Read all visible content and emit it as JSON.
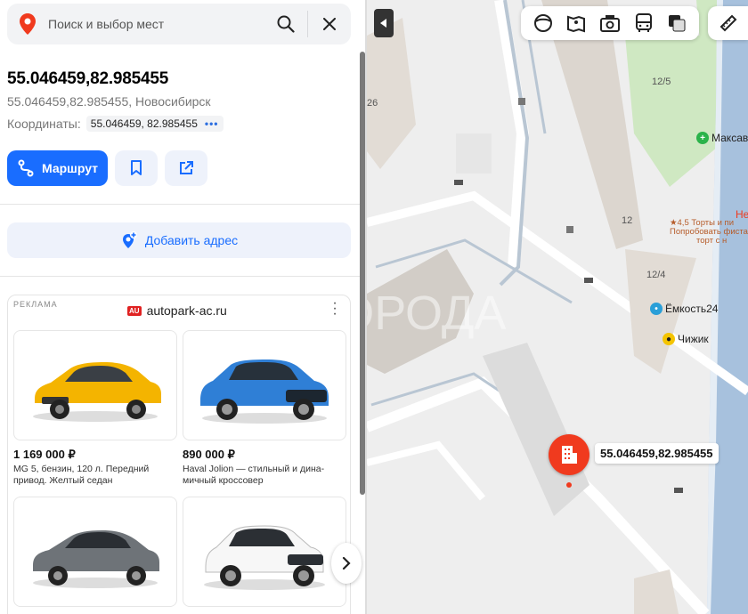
{
  "search": {
    "placeholder": "Поиск и выбор мест"
  },
  "place": {
    "title": "55.046459,82.985455",
    "subtitle": "55.046459,82.985455, Новосибирск",
    "coords_label": "Координаты:",
    "coords_value": "55.046459, 82.985455",
    "coords_more": "•••"
  },
  "actions": {
    "route_label": "Маршрут"
  },
  "add_address": {
    "label": "Добавить адрес"
  },
  "ad": {
    "label": "РЕКЛАМА",
    "brand_logo": "AU",
    "brand": "autopark-ac.ru",
    "cards": [
      {
        "price": "1 169 000 ₽",
        "desc": "MG 5, бензин, 120 л. Передний привод. Желтый седан",
        "color": "#f4b400"
      },
      {
        "price": "890 000 ₽",
        "desc": "Haval Jolion — стильный и дина-мичный кроссовер",
        "color": "#2f7fd6"
      },
      {
        "price": "",
        "desc": "",
        "color": "#6e7378"
      },
      {
        "price": "",
        "desc": "",
        "color": "#f7f7f7"
      }
    ]
  },
  "map": {
    "labels": {
      "n12_5": "12/5",
      "n12": "12",
      "n12_4": "12/4",
      "n26": "26"
    },
    "pois": {
      "maksavit": "Максав",
      "emkost": "Ёмкость24",
      "chizhik": "Чижик",
      "tort_line1": "★4,5 Торты и пи",
      "tort_line2": "Попробовать фиста",
      "tort_line3": "торт с н",
      "ne": "Не"
    },
    "marker_label": "55.046459,82.985455",
    "watermark": "ГОРОДА"
  },
  "colors": {
    "accent": "#196dff",
    "marker": "#f03a1e",
    "pharmacy": "#2bb34a",
    "water": "#a7c1dd"
  }
}
